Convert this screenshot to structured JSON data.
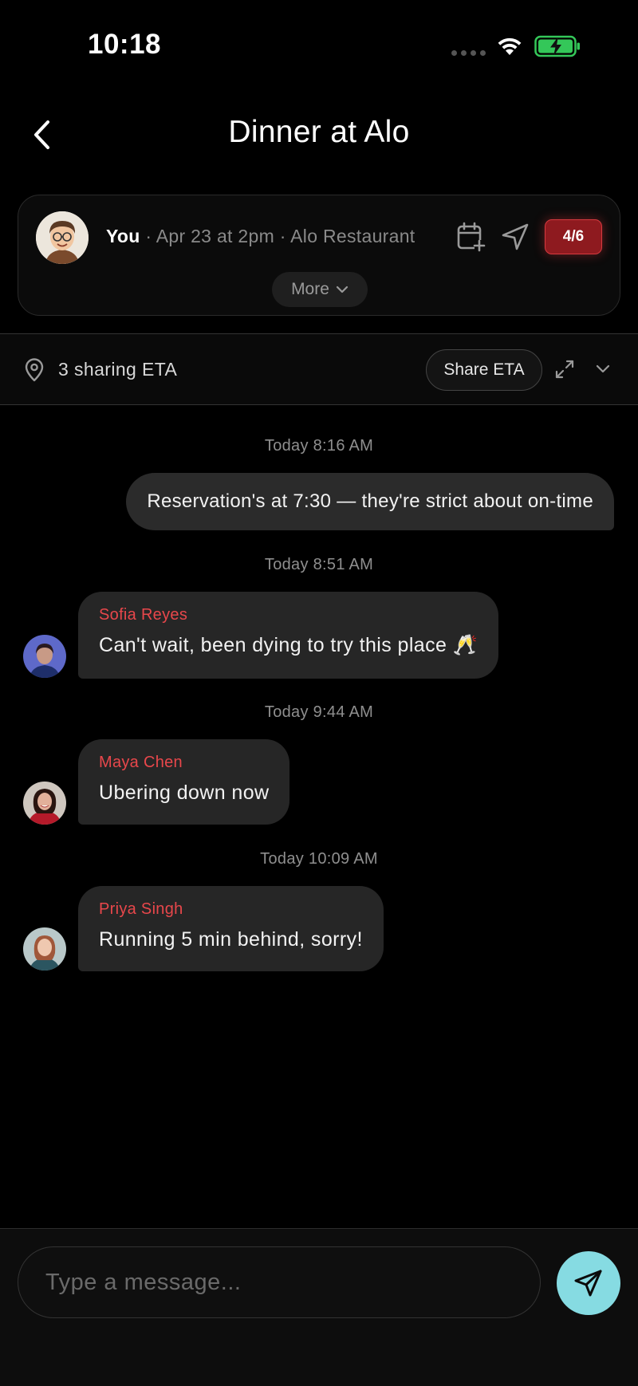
{
  "status_bar": {
    "time": "10:18"
  },
  "header": {
    "title": "Dinner at Alo"
  },
  "event": {
    "host": "You",
    "details": " · Apr 23 at 2pm · Alo Restaurant",
    "capacity": "4/6",
    "more_label": "More"
  },
  "eta": {
    "sharing_count": "3 sharing ETA",
    "share_label": "Share ETA"
  },
  "messages": [
    {
      "timestamp": "Today 8:16 AM",
      "direction": "outgoing",
      "text": "Reservation's at 7:30 — they're strict about on-time"
    },
    {
      "timestamp": "Today 8:51 AM",
      "direction": "incoming",
      "sender": "Sofia Reyes",
      "text": "Can't wait, been dying to try this place 🥂"
    },
    {
      "timestamp": "Today 9:44 AM",
      "direction": "incoming",
      "sender": "Maya Chen",
      "text": "Ubering down now"
    },
    {
      "timestamp": "Today 10:09 AM",
      "direction": "incoming",
      "sender": "Priya Singh",
      "text": "Running 5 min behind, sorry!"
    }
  ],
  "composer": {
    "placeholder": "Type a message..."
  },
  "colors": {
    "accent": "#86dbe2",
    "sender_name": "#e8474b",
    "badge_bg": "#8e1a1f",
    "battery": "#34c759"
  }
}
